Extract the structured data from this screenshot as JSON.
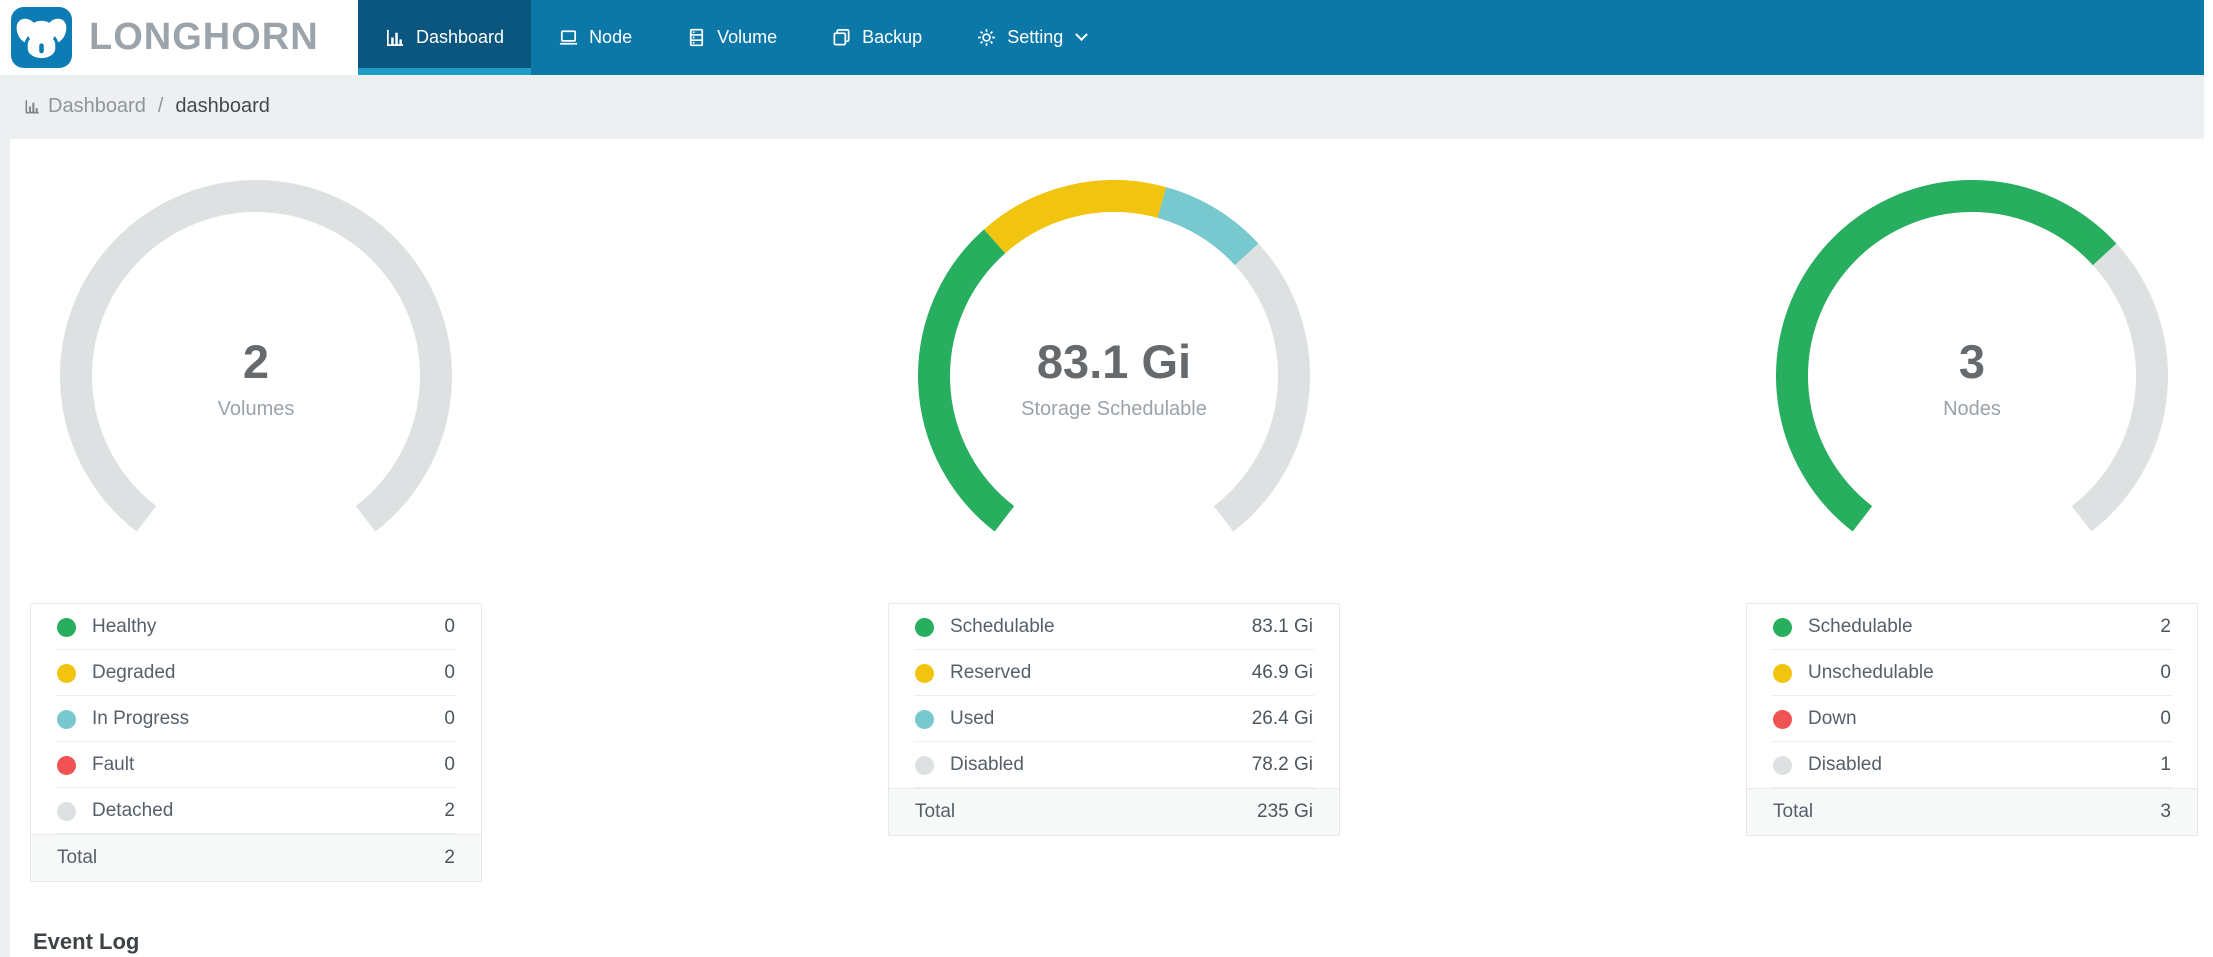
{
  "header": {
    "logo_text": "LONGHORN",
    "nav": [
      {
        "label": "Dashboard",
        "icon": "bar-chart-icon",
        "active": true
      },
      {
        "label": "Node",
        "icon": "laptop-icon",
        "active": false
      },
      {
        "label": "Volume",
        "icon": "database-icon",
        "active": false
      },
      {
        "label": "Backup",
        "icon": "copy-icon",
        "active": false
      },
      {
        "label": "Setting",
        "icon": "gear-icon",
        "active": false,
        "has_dropdown": true
      }
    ]
  },
  "breadcrumb": {
    "icon": "bar-chart-icon",
    "section": "Dashboard",
    "separator": "/",
    "page": "dashboard"
  },
  "colors": {
    "nav_bg": "#0c78a8",
    "nav_active_bg": "#0a567e",
    "nav_active_indicator": "#1e9bc7",
    "logo_blue": "#0d7cb5",
    "healthy_green": "#27AE5F",
    "warning_yellow": "#F1C40F",
    "progress_teal": "#78C9CF",
    "fault_red": "#F15354",
    "disabled_gray": "#DEE1E2"
  },
  "chart_data": [
    {
      "type": "gauge",
      "arc_degrees": 285,
      "center_value": "2",
      "center_label": "Volumes",
      "legend": [
        {
          "label": "Healthy",
          "value": 0,
          "display": "0",
          "color": "#27AE5F"
        },
        {
          "label": "Degraded",
          "value": 0,
          "display": "0",
          "color": "#F1C40F"
        },
        {
          "label": "In Progress",
          "value": 0,
          "display": "0",
          "color": "#78C9CF"
        },
        {
          "label": "Fault",
          "value": 0,
          "display": "0",
          "color": "#F15354"
        },
        {
          "label": "Detached",
          "value": 2,
          "display": "2",
          "color": "#DEE1E2"
        }
      ],
      "total": {
        "label": "Total",
        "display": "2"
      }
    },
    {
      "type": "gauge",
      "arc_degrees": 285,
      "center_value": "83.1 Gi",
      "center_label": "Storage Schedulable",
      "legend": [
        {
          "label": "Schedulable",
          "value": 83.1,
          "display": "83.1 Gi",
          "color": "#27AE5F"
        },
        {
          "label": "Reserved",
          "value": 46.9,
          "display": "46.9 Gi",
          "color": "#F1C40F"
        },
        {
          "label": "Used",
          "value": 26.4,
          "display": "26.4 Gi",
          "color": "#78C9CF"
        },
        {
          "label": "Disabled",
          "value": 78.2,
          "display": "78.2 Gi",
          "color": "#DEE1E2"
        }
      ],
      "total": {
        "label": "Total",
        "display": "235 Gi"
      }
    },
    {
      "type": "gauge",
      "arc_degrees": 285,
      "center_value": "3",
      "center_label": "Nodes",
      "legend": [
        {
          "label": "Schedulable",
          "value": 2,
          "display": "2",
          "color": "#27AE5F"
        },
        {
          "label": "Unschedulable",
          "value": 0,
          "display": "0",
          "color": "#F1C40F"
        },
        {
          "label": "Down",
          "value": 0,
          "display": "0",
          "color": "#F15354"
        },
        {
          "label": "Disabled",
          "value": 1,
          "display": "1",
          "color": "#DEE1E2"
        }
      ],
      "total": {
        "label": "Total",
        "display": "3"
      }
    }
  ],
  "event_log": {
    "title": "Event Log"
  }
}
